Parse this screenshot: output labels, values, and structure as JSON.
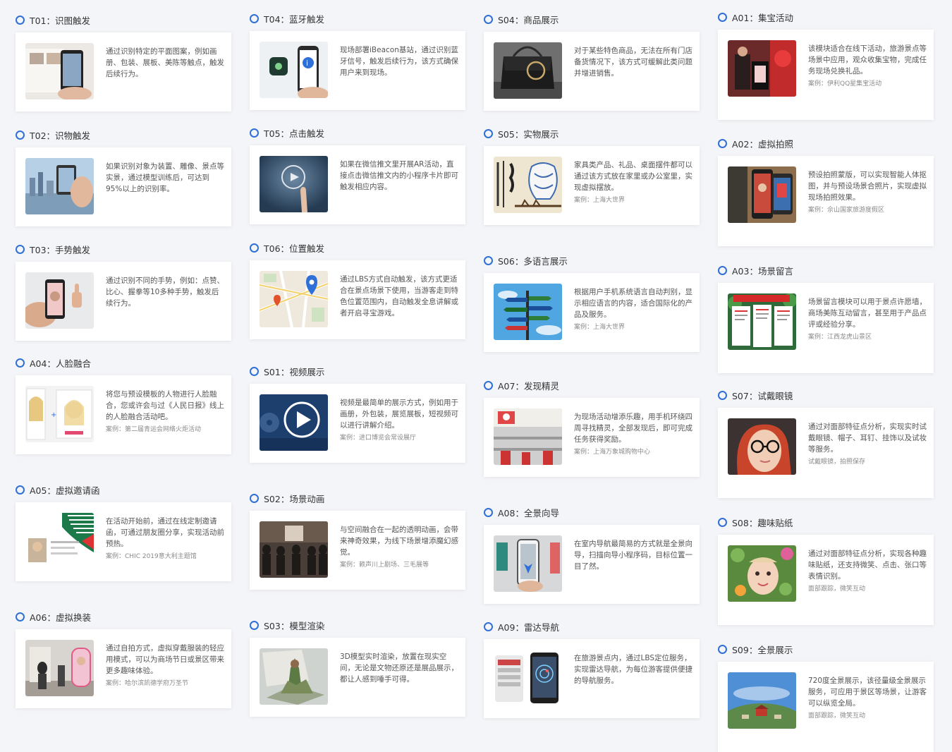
{
  "columns": [
    {
      "items": [
        {
          "title": "T01：识图触发",
          "desc": "通过识别特定的平面图案，例如画册、包装、展板、美陈等触点，触发后续行为。",
          "case": "",
          "icon": "phone-scan-icon"
        },
        {
          "title": "T02：识物触发",
          "desc": "如果识别对象为装置、雕像、景点等实景，通过模型训练后，可达到95%以上的识别率。",
          "case": "",
          "icon": "city-scan-icon"
        },
        {
          "title": "T03：手势触发",
          "desc": "通过识别不同的手势，例如：点赞、比心、握拳等10多种手势，触发后续行为。",
          "case": "",
          "icon": "thumbs-up-icon"
        },
        {
          "title": "A04：人脸融合",
          "desc": "将您与预设模板的人物进行人脸融合，您或许会与过《人民日报》线上的人脸融合活动吧。",
          "case": "案例：第二届青运会网络火炬活动",
          "icon": "face-fusion-icon"
        },
        {
          "title": "A05：虚拟邀请函",
          "desc": "在活动开始前，通过在线定制邀请函，可通过朋友圈分享，实现活动前预热。",
          "case": "案例：CHIC 2019意大利主题馆",
          "icon": "invitation-icon"
        },
        {
          "title": "A06：虚拟换装",
          "desc": "通过自拍方式，虚拟穿戴服装的轻应用模式，可以为商场节日或景区带来更多趣味体验。",
          "case": "案例：哈尔滨凯德学府万圣节",
          "icon": "dress-up-icon"
        }
      ]
    },
    {
      "items": [
        {
          "title": "T04：蓝牙触发",
          "desc": "现场部署iBeacon基站，通过识别蓝牙信号，触发后续行为，该方式确保用户来到现场。",
          "case": "",
          "icon": "bluetooth-beacon-icon"
        },
        {
          "title": "T05：点击触发",
          "desc": "如果在微信推文里开展AR活动，直接点击微信推文内的小程序卡片即可触发相应内容。",
          "case": "",
          "icon": "tap-icon"
        },
        {
          "title": "T06：位置触发",
          "desc": "通过LBS方式自动触发，该方式更适合在景点场景下使用，当游客走到特色位置范围内，自动触发全息讲解或者开启寻宝游戏。",
          "case": "",
          "icon": "map-pin-icon"
        },
        {
          "title": "S01：视频展示",
          "desc": "视频是最简单的展示方式，例如用于画册，外包装，展览展板，短视频可以进行讲解介绍。",
          "case": "案例：进口博览会常设展厅",
          "icon": "video-play-icon"
        },
        {
          "title": "S02：场景动画",
          "desc": "与空间融合在一起的透明动画，会带来神奇效果，为线下场景增添魔幻感觉。",
          "case": "案例：赖声川上剧场、三毛展等",
          "icon": "stage-scene-icon"
        },
        {
          "title": "S03：模型渲染",
          "desc": "3D模型实时渲染，放置在现实空间，无论是文物还原还是展品展示，都让人感到唾手可得。",
          "case": "",
          "icon": "3d-model-icon"
        }
      ]
    },
    {
      "items": [
        {
          "title": "S04：商品展示",
          "desc": "对于某些特色商品，无法在所有门店备货情况下，该方式可缓解此类问题并增进销售。",
          "case": "",
          "icon": "handbag-icon"
        },
        {
          "title": "S05：实物展示",
          "desc": "家具类产品、礼品、桌面摆件都可以通过该方式放在家里或办公室里，实现虚拟摆放。",
          "case": "案例：上海大世界",
          "icon": "porcelain-icon"
        },
        {
          "title": "S06：多语言展示",
          "desc": "根据用户手机系统语言自动判别，显示相应语言的内容，适合国际化的产品及服务。",
          "case": "案例：上海大世界",
          "icon": "signpost-icon"
        },
        {
          "title": "A07：发现精灵",
          "desc": "为现场活动增添乐趣，用手机环绕四周寻找精灵，全部发现后，即可完成任务获得奖励。",
          "case": "案例：上海万象城购物中心",
          "icon": "mall-search-icon"
        },
        {
          "title": "A08：全景向导",
          "desc": "在室内导航最简易的方式就是全景向导，扫描向导小程序码，目标位置一目了然。",
          "case": "",
          "icon": "indoor-guide-icon"
        },
        {
          "title": "A09：雷达导航",
          "desc": "在旅游景点内，通过LBS定位服务，实现雷达导航，为每位游客提供便捷的导航服务。",
          "case": "",
          "icon": "radar-nav-icon"
        }
      ]
    },
    {
      "items": [
        {
          "title": "A01：集宝活动",
          "desc": "该模块适合在线下活动，旅游景点等场景中应用，观众收集宝物，完成任务现场兑换礼品。",
          "case": "案例：伊利QQ星集宝活动",
          "icon": "treasure-hunt-icon"
        },
        {
          "title": "A02：虚拟拍照",
          "desc": "预设拍照蒙版，可以实现智能人体抠图，并与预设场景合照片，实现虚拟现场拍照效果。",
          "case": "案例：佘山国家旅游度假区",
          "icon": "virtual-photo-icon"
        },
        {
          "title": "A03：场景留言",
          "desc": "场景留言模块可以用于景点许愿墙，商场美陈互动留言，甚至用于产品点评或经验分享。",
          "case": "案例：江西龙虎山景区",
          "icon": "message-wall-icon"
        },
        {
          "title": "S07：试戴眼镜",
          "desc": "通过对面部特征点分析，实现实时试戴眼镜、帽子、耳钉、挂饰以及试妆等服务。",
          "case": "试戴眼镜，拍照保存",
          "icon": "glasses-icon"
        },
        {
          "title": "S08：趣味贴纸",
          "desc": "通过对面部特征点分析，实现各种趣味贴纸，还支持微笑、点击、张口等表情识别。",
          "case": "面部跟踪，微笑互动",
          "icon": "sticker-icon"
        },
        {
          "title": "S09：全景展示",
          "desc": "720度全景展示，该径量级全景展示服务，可应用于景区等场景，让游客可以纵览全局。",
          "case": "面部跟踪，微笑互动",
          "icon": "panorama-icon"
        }
      ]
    }
  ],
  "colors": {
    "accent": "#2f6fd8",
    "card": "#ffffff",
    "background": "#f4f5f8"
  }
}
